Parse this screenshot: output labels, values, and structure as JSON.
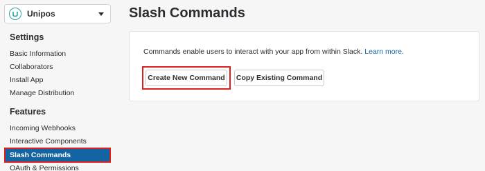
{
  "sidebar": {
    "app": {
      "name": "Unipos",
      "icon": "unipos-logo-icon"
    },
    "sections": {
      "settings": {
        "title": "Settings",
        "items": [
          "Basic Information",
          "Collaborators",
          "Install App",
          "Manage Distribution"
        ]
      },
      "features": {
        "title": "Features",
        "items": [
          "Incoming Webhooks",
          "Interactive Components",
          "Slash Commands",
          "OAuth & Permissions"
        ],
        "active_index": 2
      }
    }
  },
  "main": {
    "title": "Slash Commands",
    "card": {
      "description": "Commands enable users to interact with your app from within Slack.",
      "learn_more": "Learn more.",
      "create_button": "Create New Command",
      "copy_button": "Copy Existing Command"
    }
  },
  "colors": {
    "accent": "#1264a3",
    "highlight": "#e01e1e",
    "app_icon": "#2aa3a0"
  }
}
